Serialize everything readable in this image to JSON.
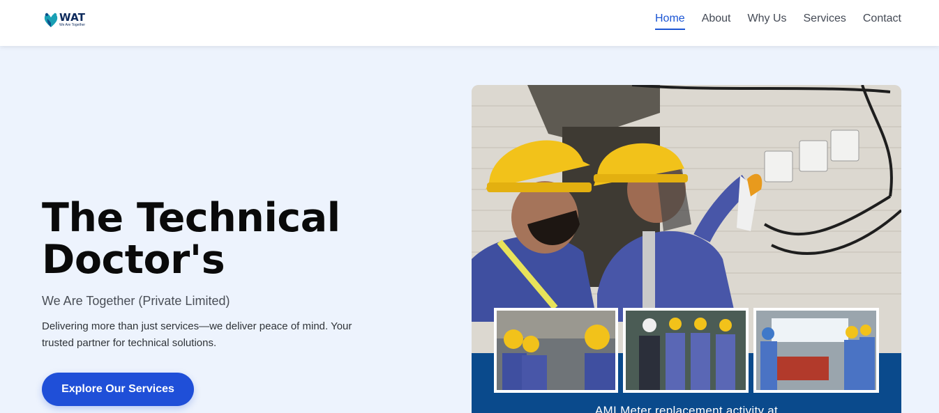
{
  "header": {
    "logo": {
      "text": "WAT",
      "tagline": "We Are Together"
    },
    "nav": [
      {
        "label": "Home",
        "active": true
      },
      {
        "label": "About",
        "active": false
      },
      {
        "label": "Why Us",
        "active": false
      },
      {
        "label": "Services",
        "active": false
      },
      {
        "label": "Contact",
        "active": false
      }
    ]
  },
  "hero": {
    "title": "The Technical Doctor's",
    "subtitle": "We Are Together (Private Limited)",
    "description": "Delivering more than just services—we deliver peace of mind. Your trusted partner for technical solutions.",
    "cta_label": "Explore Our Services",
    "image_caption": "AMI Meter replacement activity at"
  },
  "colors": {
    "accent": "#1f4fd8",
    "nav_active": "#1b55d4",
    "background": "#edf3fd",
    "image_band": "#0a4a8c"
  }
}
